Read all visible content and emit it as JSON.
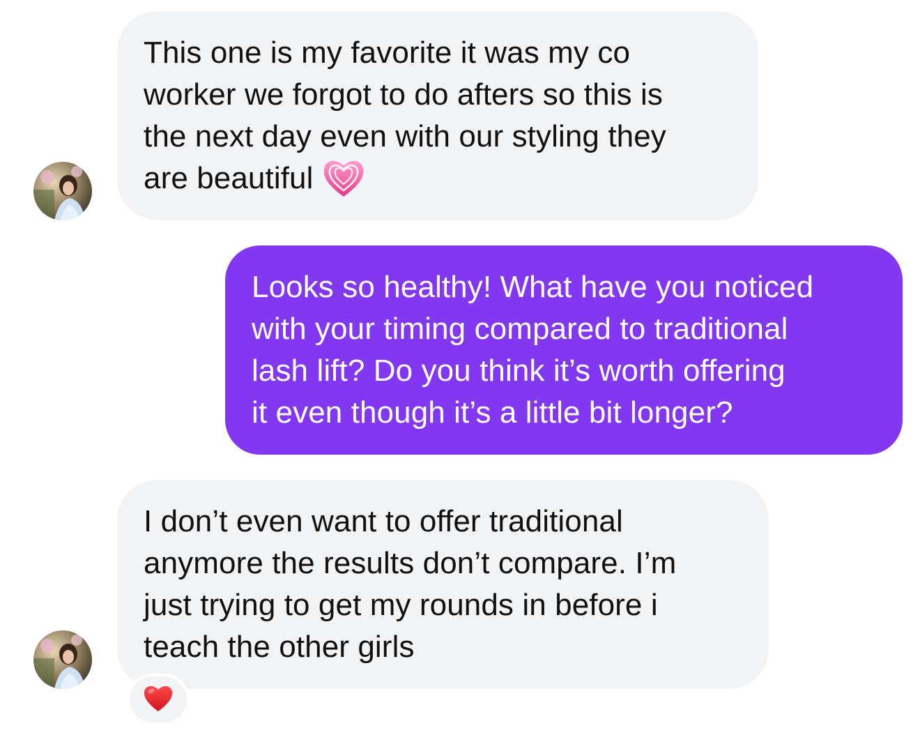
{
  "messages": [
    {
      "direction": "incoming",
      "lines": [
        "This one is my favorite it was my co",
        "worker we forgot to do afters so this is",
        "the next day even with our styling they",
        "are beautiful"
      ],
      "trailing_emoji": "growing-heart-icon"
    },
    {
      "direction": "outgoing",
      "lines": [
        "Looks so healthy! What have you noticed",
        "with your timing compared to traditional",
        "lash lift? Do you think it’s worth offering",
        "it even though it’s a little bit longer?"
      ]
    },
    {
      "direction": "incoming",
      "lines": [
        "I don’t even want to offer traditional",
        "anymore the results don’t compare. I’m",
        "just trying to get my rounds in before i",
        "teach the other girls"
      ],
      "reaction": "red-heart-icon"
    }
  ],
  "colors": {
    "incoming_bubble": "#f2f3f5",
    "outgoing_bubble": "#8237f0",
    "incoming_text": "#111111",
    "outgoing_text": "#ffffff",
    "heart_red": "#e4262c",
    "heart_pink": "#f2609a"
  }
}
